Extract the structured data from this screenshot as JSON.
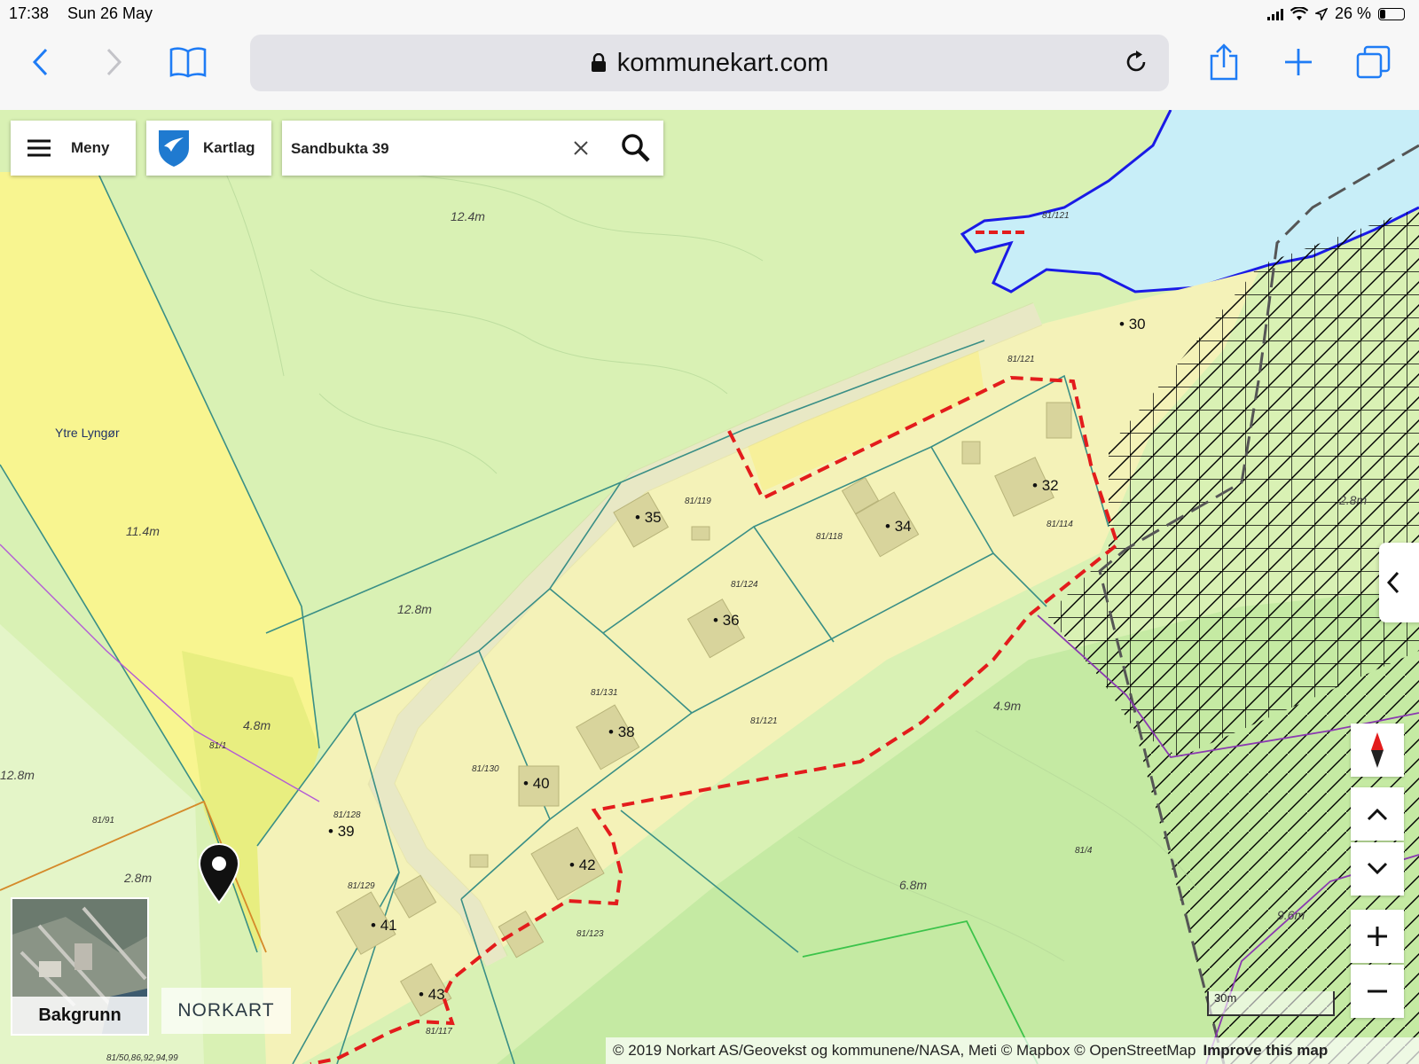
{
  "status_bar": {
    "time": "17:38",
    "date": "Sun 26 May",
    "battery": "26 %"
  },
  "browser": {
    "url": "kommunekart.com"
  },
  "map_ui": {
    "menu_label": "Meny",
    "layers_label": "Kartlag",
    "search_value": "Sandbukta 39",
    "background_label": "Bakgrunn",
    "brand": "NORKART",
    "scale": "30m",
    "attribution": "© 2019 Norkart AS/Geovekst og kommunene/NASA, Meti © Mapbox © OpenStreetMap",
    "attribution_link": "Improve this map"
  },
  "map": {
    "place_name": "Ytre Lyngør",
    "elevations": [
      "12.4m",
      "11.4m",
      "12.8m",
      "4.8m",
      "12.8m",
      "2.8m",
      "2.8m",
      "4.9m",
      "6.8m",
      "9.6m"
    ],
    "house_numbers": [
      "30",
      "32",
      "34",
      "35",
      "36",
      "38",
      "39",
      "40",
      "41",
      "42",
      "43"
    ],
    "parcels": [
      "81/121",
      "81/121",
      "81/119",
      "81/118",
      "81/114",
      "81/124",
      "81/131",
      "81/121",
      "81/130",
      "81/128",
      "81/1",
      "81/91",
      "81/129",
      "81/123",
      "81/117",
      "81/4",
      "81/50,86,92,94,99"
    ]
  },
  "colors": {
    "light_green": "#d9f1b4",
    "yellow_zone": "#f8f590",
    "residential": "#f4f2b8",
    "water": "#c8eef8",
    "boundary_red": "#e31c1c",
    "shoreline_blue": "#1a1ae6",
    "parcel_line": "#3a8f86",
    "accent_blue": "#1f7cf5"
  }
}
